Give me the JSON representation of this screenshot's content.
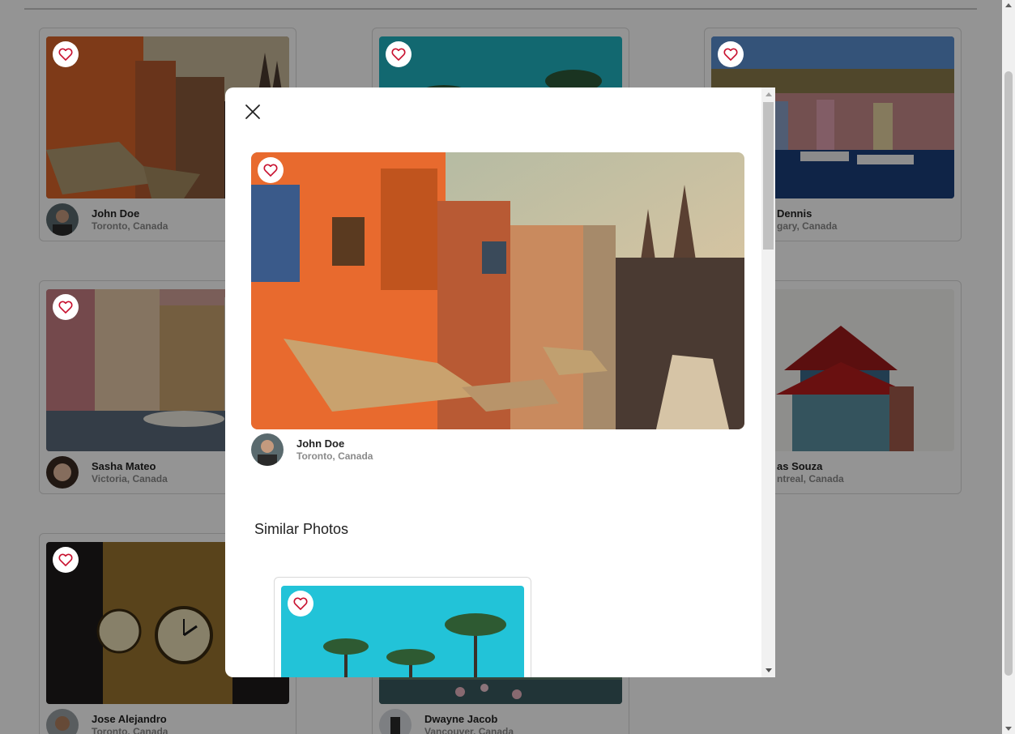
{
  "grid": {
    "cards": [
      {
        "name": "John Doe",
        "location": "Toronto, Canada"
      },
      {
        "name": "",
        "location": ""
      },
      {
        "name": "Dennis",
        "location": "gary, Canada"
      },
      {
        "name": "Sasha Mateo",
        "location": "Victoria, Canada"
      },
      {
        "name": "",
        "location": ""
      },
      {
        "name": "as Souza",
        "location": "ntreal, Canada"
      },
      {
        "name": "Jose Alejandro",
        "location": "Toronto, Canada"
      },
      {
        "name": "Dwayne Jacob",
        "location": "Vancouver, Canada"
      }
    ]
  },
  "modal": {
    "photo": {
      "name": "John Doe",
      "location": "Toronto, Canada"
    },
    "similar_title": "Similar Photos"
  },
  "icons": {
    "heart": "heart-icon",
    "close": "close-icon"
  },
  "colors": {
    "heart": "#c8102e",
    "overlay": "rgba(0,0,0,0.42)"
  }
}
